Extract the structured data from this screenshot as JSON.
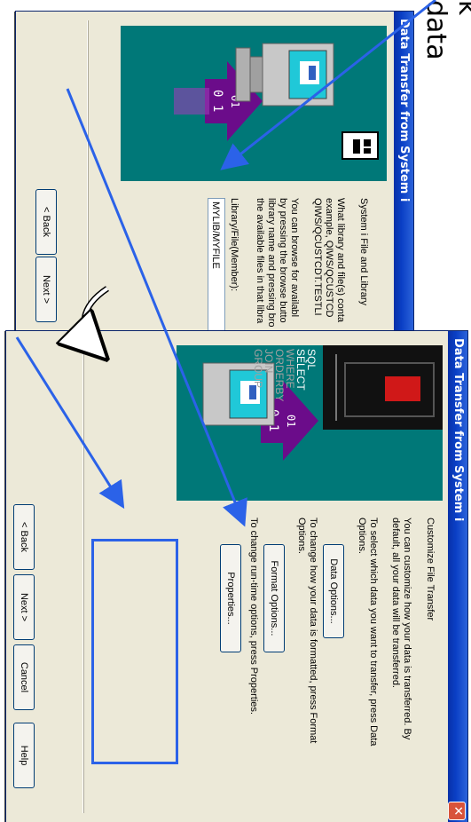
{
  "annotation": {
    "label": "data",
    "partial_label": "k"
  },
  "dialog1": {
    "title": "Data Transfer from System i",
    "heading": "System i File and Library",
    "para1": [
      "What library and file(s) conta",
      "example, QIWS/QCUSTCD",
      "QIWS/QCUSTCDT.TESTLI"
    ],
    "para2": [
      "You can browse for availabl",
      "by pressing the browse butto",
      "library name and pressing bro",
      "the available files in that libra"
    ],
    "field_label": "Library/File(Member):",
    "field_value": "MYLIB/MYFILE",
    "back": "< Back",
    "next": "Next >"
  },
  "dialog2": {
    "title": "Data Transfer from System i",
    "heading": "Customize File Transfer",
    "para1": [
      "You can customize how your data is transferred.  By",
      "default, all your data will be transferred."
    ],
    "para2": [
      "To select which data you want to transfer, press Data",
      "Options."
    ],
    "data_options": "Data Options...",
    "para3": [
      "To change how your data is formatted, press Format",
      "Options."
    ],
    "format_options": "Format Options...",
    "para4": "To change run-time options, press Properties.",
    "properties": "Properties...",
    "back": "< Back",
    "next": "Next >",
    "cancel": "Cancel",
    "help": "Help",
    "sql_words": [
      "SQL",
      "SELECT",
      "WHERE",
      "ORDERBY",
      "JOIN",
      "GROUP"
    ]
  },
  "colors": {
    "accent": "#2B62E8",
    "titlebar": "#0A3FC5",
    "teal": "#007878",
    "arrow": "#6B0C8A"
  }
}
